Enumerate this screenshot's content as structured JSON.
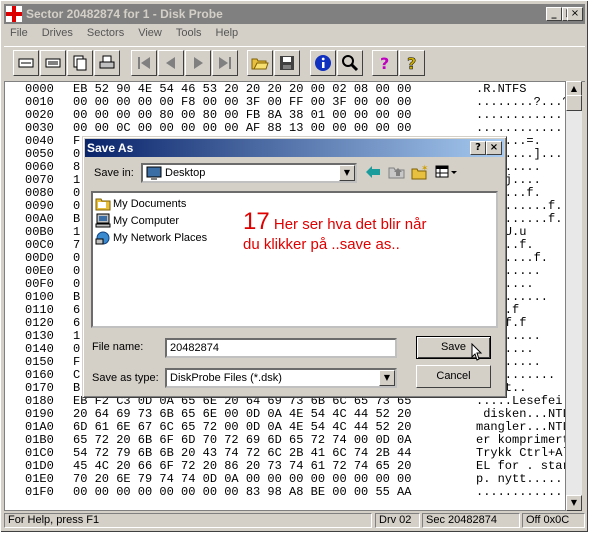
{
  "window": {
    "title": "Sector 20482874 for 1 - Disk Probe",
    "controls": [
      "_",
      "□",
      "×"
    ]
  },
  "menu": [
    "File",
    "Drives",
    "Sectors",
    "View",
    "Tools",
    "Help"
  ],
  "toolbar": {
    "icons": [
      "read-icon",
      "write-icon",
      "copy-icon",
      "print-icon",
      "first-sector-icon",
      "prev-sector-icon",
      "next-sector-icon",
      "last-sector-icon",
      "open-icon",
      "save-icon",
      "info-icon",
      "search-icon",
      "help-icon",
      "context-help-icon"
    ]
  },
  "hex_rows": [
    {
      "offset": "0000",
      "bytes": "EB 52 90 4E 54 46 53 20 20 20 20 00 02 08 00 00",
      "ascii": ".R.NTFS"
    },
    {
      "offset": "0010",
      "bytes": "00 00 00 00 00 F8 00 00 3F 00 FF 00 3F 00 00 00",
      "ascii": "........?...?..."
    },
    {
      "offset": "0020",
      "bytes": "00 00 00 00 80 00 80 00 FB 8A 38 01 00 00 00 00",
      "ascii": "..............8."
    },
    {
      "offset": "0030",
      "bytes": "00 00 0C 00 00 00 00 00 AF 88 13 00 00 00 00 00",
      "ascii": "................"
    },
    {
      "offset": "0040",
      "bytes": "F",
      "ascii": ".......=."
    },
    {
      "offset": "0050",
      "bytes": "0",
      "ascii": "..3.....]...."
    },
    {
      "offset": "0060",
      "bytes": "8",
      "ascii": "...3....."
    },
    {
      "offset": "0070",
      "bytes": "1",
      "ascii": "h..hj...."
    },
    {
      "offset": "0080",
      "bytes": "0",
      "ascii": ".......f."
    },
    {
      "offset": "0090",
      "bytes": "0",
      "ascii": "f.........f."
    },
    {
      "offset": "00A0",
      "bytes": "B",
      "ascii": "f.........f..f"
    },
    {
      "offset": "00B0",
      "bytes": "1",
      "ascii": "r...U.u"
    },
    {
      "offset": "00C0",
      "bytes": "7",
      "ascii": "..f`..f."
    },
    {
      "offset": "00D0",
      "bytes": "0",
      "ascii": "........f."
    },
    {
      "offset": "00E0",
      "bytes": "0",
      "ascii": "5fh......"
    },
    {
      "offset": "00F0",
      "bytes": "0",
      "ascii": "........"
    },
    {
      "offset": "0100",
      "bytes": "B",
      "ascii": "..>......."
    },
    {
      "offset": "0110",
      "bytes": "6",
      "ascii": "..f3.f"
    },
    {
      "offset": "0120",
      "bytes": "6",
      "ascii": ".f..f.f"
    },
    {
      "offset": "0130",
      "bytes": "1",
      "ascii": "..$......"
    },
    {
      "offset": "0140",
      "bytes": "0",
      "ascii": "........"
    },
    {
      "offset": "0150",
      "bytes": "F",
      "ascii": "........."
    },
    {
      "offset": "0160",
      "bytes": "C",
      "ascii": "..........."
    },
    {
      "offset": "0170",
      "bytes": "B",
      "ascii": "..<.t.."
    },
    {
      "offset": "0180",
      "bytes": "EB F2 C3 0D 0A 65 6E 20 64 69 73 6B 6C 65 73 65",
      "ascii": ".....Lesefei"
    },
    {
      "offset": "0190",
      "bytes": "20 64 69 73 6B 65 6E 00 0D 0A 4E 54 4C 44 52 20",
      "ascii": " disken...NTLDR"
    },
    {
      "offset": "01A0",
      "bytes": "6D 61 6E 67 6C 65 72 00 0D 0A 4E 54 4C 44 52 20",
      "ascii": "mangler...NTLDR"
    },
    {
      "offset": "01B0",
      "bytes": "65 72 20 6B 6F 6D 70 72 69 6D 65 72 74 00 0D 0A",
      "ascii": "er komprimert.."
    },
    {
      "offset": "01C0",
      "bytes": "54 72 79 6B 6B 20 43 74 72 6C 2B 41 6C 74 2B 44",
      "ascii": "Trykk Ctrl+Alt+D"
    },
    {
      "offset": "01D0",
      "bytes": "45 4C 20 66 6F 72 20 86 20 73 74 61 72 74 65 20",
      "ascii": "EL for . starte"
    },
    {
      "offset": "01E0",
      "bytes": "70 20 6E 79 74 74 0D 0A 00 00 00 00 00 00 00 00",
      "ascii": "p. nytt........."
    },
    {
      "offset": "01F0",
      "bytes": "00 00 00 00 00 00 00 00 83 98 A8 BE 00 00 55 AA",
      "ascii": "..............U."
    }
  ],
  "status": {
    "help": "For Help, press F1",
    "drive": "Drv  02",
    "sector": "Sec 20482874",
    "offset": "Off 0x0C"
  },
  "dialog": {
    "title": "Save As",
    "controls": [
      "?",
      "×"
    ],
    "save_in_label": "Save in:",
    "save_in_value": "Desktop",
    "items": [
      {
        "label": "My Documents",
        "icon": "folder-icon"
      },
      {
        "label": "My Computer",
        "icon": "computer-icon"
      },
      {
        "label": "My Network Places",
        "icon": "network-icon"
      }
    ],
    "filename_label": "File name:",
    "filename_value": "20482874",
    "savetype_label": "Save as type:",
    "savetype_value": "DiskProbe Files (*.dsk)",
    "save_button": "Save",
    "cancel_button": "Cancel"
  },
  "annotation": {
    "number": "17",
    "line1": " Her ser hva det blir når",
    "line2": "du klikker på ..save as.."
  }
}
